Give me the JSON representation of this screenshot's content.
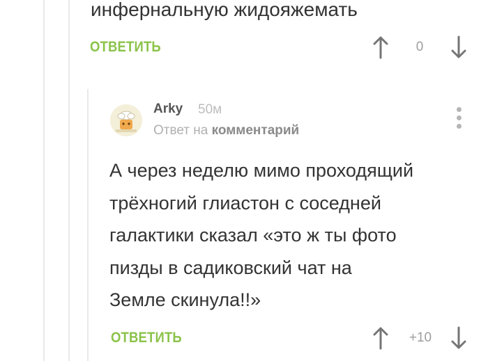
{
  "previous_comment": {
    "text_tail": "инфернальную жидояжемать",
    "reply_label": "ОТВЕТИТЬ",
    "score": "0"
  },
  "reply": {
    "author": "Arky",
    "time_ago": "50м",
    "reply_prefix": "Ответ на",
    "reply_target": "комментарий",
    "lines": [
      "А через неделю мимо проходящий",
      "трёхногий глиастон с соседней",
      "галактики сказал «это ж ты фото",
      "пизды в садиковский чат на",
      "Земле скинула!!»"
    ],
    "reply_label": "ОТВЕТИТЬ",
    "score": "+10"
  },
  "icons": {
    "vote_up": "arrow-up-icon",
    "vote_down": "arrow-down-icon",
    "more": "more-vertical-icon",
    "avatar": "avatar-image"
  },
  "colors": {
    "accent": "#8bc34a",
    "muted": "#9e9e9e",
    "text": "#333333"
  }
}
